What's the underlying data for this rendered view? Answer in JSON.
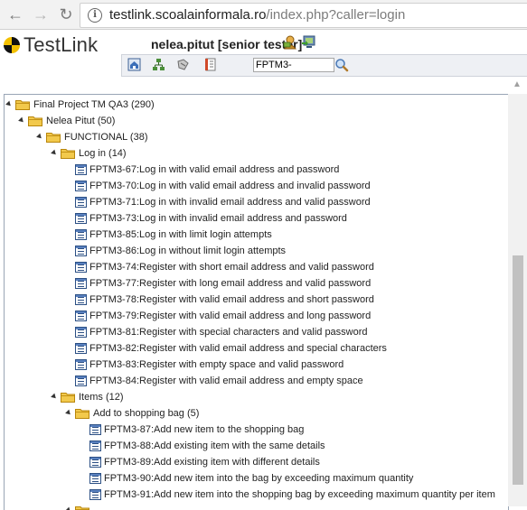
{
  "browser": {
    "url_host": "testlink.scoalainformala.ro",
    "url_path": "/index.php?caller=login",
    "back_icon": "back-arrow-icon",
    "forward_icon": "forward-arrow-icon",
    "reload_icon": "reload-icon"
  },
  "app": {
    "logo_text": "TestLink",
    "user": "nelea.pitut [senior tester]",
    "search_value": "FPTM3-"
  },
  "tree": {
    "root": "Final Project TM QA3 (290)",
    "owner": "Nelea Pitut (50)",
    "functional": "FUNCTIONAL (38)",
    "login": "Log in (14)",
    "login_cases": [
      "FPTM3-67:Log in with valid email address and password",
      "FPTM3-70:Log in with valid email address and invalid password",
      "FPTM3-71:Log in with invalid email address and valid password",
      "FPTM3-73:Log in with invalid email address and password",
      "FPTM3-85:Log in with limit login attempts",
      "FPTM3-86:Log in without limit login attempts",
      "FPTM3-74:Register with short email address and valid password",
      "FPTM3-77:Register with long email address and valid password",
      "FPTM3-78:Register with valid email address and short password",
      "FPTM3-79:Register with valid email address and long password",
      "FPTM3-81:Register with special characters and valid password",
      "FPTM3-82:Register with valid email address and special characters",
      "FPTM3-83:Register with empty space and valid password",
      "FPTM3-84:Register with valid email address and empty space"
    ],
    "items": "Items (12)",
    "bag": "Add to shopping bag (5)",
    "bag_cases": [
      "FPTM3-87:Add new item to the shopping bag",
      "FPTM3-88:Add existing item with the same details",
      "FPTM3-89:Add existing item with different details",
      "FPTM3-90:Add new item into the bag by exceeding maximum quantity",
      "FPTM3-91:Add new item into the shopping bag by exceeding maximum quantity per item"
    ]
  },
  "colors": {
    "folder": "#f2c94c",
    "testcase": "#2b4f84",
    "scroll_thumb": "#c1c1c1"
  }
}
